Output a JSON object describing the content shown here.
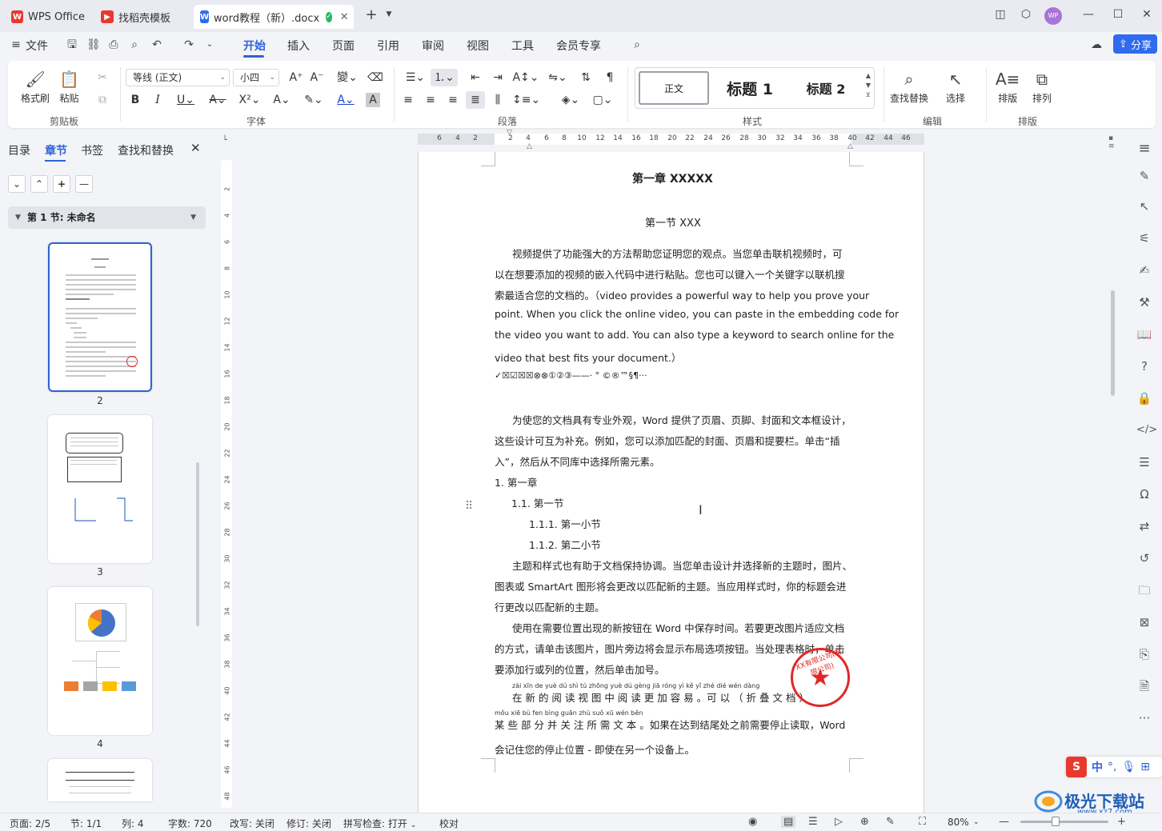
{
  "titlebar": {
    "tabs": [
      {
        "label": "WPS Office",
        "logo": "W",
        "logo_color": "#e8392f"
      },
      {
        "label": "找稻壳模板",
        "logo": "▶",
        "logo_color": "#e8392f"
      },
      {
        "label": "word教程（新）.docx",
        "logo": "W",
        "logo_color": "#2f6bf0",
        "active": true
      }
    ],
    "new_tab": "+",
    "avatar": "WP"
  },
  "menubar": {
    "file": "文件",
    "items": [
      "开始",
      "插入",
      "页面",
      "引用",
      "审阅",
      "视图",
      "工具",
      "会员专享"
    ],
    "active": "开始",
    "share": "分享"
  },
  "ribbon": {
    "clipboard": {
      "format_painter": "格式刷",
      "paste": "粘贴",
      "label": "剪贴板"
    },
    "font": {
      "family": "等线 (正文)",
      "size": "小四",
      "label": "字体"
    },
    "paragraph": {
      "label": "段落"
    },
    "styles": {
      "normal": "正文",
      "h1": "标题 1",
      "h2": "标题 2",
      "label": "样式"
    },
    "edit": {
      "find_replace": "查找替换",
      "select": "选择",
      "label": "编辑"
    },
    "arrange": {
      "layout": "排版",
      "order": "排列",
      "label": "排版"
    }
  },
  "leftpanel": {
    "tabs": [
      "目录",
      "章节",
      "书签",
      "查找和替换"
    ],
    "active_tab": "章节",
    "section": "第 1 节: 未命名",
    "pages": [
      "2",
      "3",
      "4"
    ]
  },
  "ruler": {
    "h_numbers": [
      "6",
      "4",
      "2",
      "2",
      "4",
      "6",
      "8",
      "10",
      "12",
      "14",
      "16",
      "18",
      "20",
      "22",
      "24",
      "26",
      "28",
      "30",
      "32",
      "34",
      "36",
      "38",
      "40",
      "42",
      "44",
      "46"
    ],
    "v_numbers": [
      "2",
      "4",
      "6",
      "8",
      "10",
      "12",
      "14",
      "16",
      "18",
      "20",
      "22",
      "24",
      "26",
      "28",
      "30",
      "32",
      "34",
      "36",
      "38",
      "40",
      "42",
      "44",
      "46",
      "48"
    ]
  },
  "document": {
    "chapter_title": "第一章  XXXXX",
    "section_title": "第一节  XXX",
    "p1": [
      "视频提供了功能强大的方法帮助您证明您的观点。当您单击联机视频时，可",
      "以在想要添加的视频的嵌入代码中进行粘贴。您也可以键入一个关键字以联机搜",
      "索最适合您的文档的。（video provides a powerful way to help you prove your",
      "point. When you click the online video, you can paste in the embedding code for",
      "the video you want to add. You can also type a keyword to search online for the",
      "video that best fits your document.）"
    ],
    "symbols": "✓☒☑☒☒⊗⊗①②③——·  °  ©®™§¶···",
    "p2": [
      "为使您的文档具有专业外观，Word  提供了页眉、页脚、封面和文本框设计，",
      "这些设计可互为补充。例如，您可以添加匹配的封面、页眉和提要栏。单击“插",
      "入”，然后从不同库中选择所需元素。"
    ],
    "list": [
      "1.    第一章",
      "1.1.  第一节",
      "1.1.1.   第一小节",
      "1.1.2.   第二小节"
    ],
    "p3": [
      "主题和样式也有助于文档保持协调。当您单击设计并选择新的主题时，图片、",
      "图表或  SmartArt  图形将会更改以匹配新的主题。当应用样式时，你的标题会进",
      "行更改以匹配新的主题。"
    ],
    "p4": [
      "使用在需要位置出现的新按钮在  Word  中保存时间。若要更改图片适应文档",
      "的方式，请单击该图片，图片旁边将会显示布局选项按钮。当处理表格时，单击",
      "要添加行或列的位置，然后单击加号。"
    ],
    "pinyin1": "zài  xīn   de   yuè  dú   shì  tú   zhōng  yuè  dú  gèng  jiā  róng  yì       kě   yǐ          zhé  dié  wén  dàng",
    "p5a": "在 新 的 阅 读 视 图 中 阅 读 更 加 容 易 。可 以 （ 折 叠 文 档 ）",
    "pinyin2": "mǒu xiē bù fen bìng guān zhù suǒ xū wén běn",
    "p5b": "某 些 部 分 并 关 注 所 需 文 本 。如果在达到结尾处之前需要停止读取，Word",
    "p5c": "会记住您的停止位置  -  即使在另一个设备上。",
    "stamp_text": "XX有限公司(有限公司)"
  },
  "statusbar": {
    "page": "页面: 2/5",
    "section": "节: 1/1",
    "col": "列: 4",
    "words": "字数: 720",
    "revise": "改写: 关闭",
    "track": "修订: 关闭",
    "spell": "拼写检查: 打开",
    "proof": "校对",
    "zoom": "80%"
  },
  "overlay": {
    "ime": "中",
    "watermark": "极光下载站",
    "watermark_url": "www.xz7.com"
  }
}
